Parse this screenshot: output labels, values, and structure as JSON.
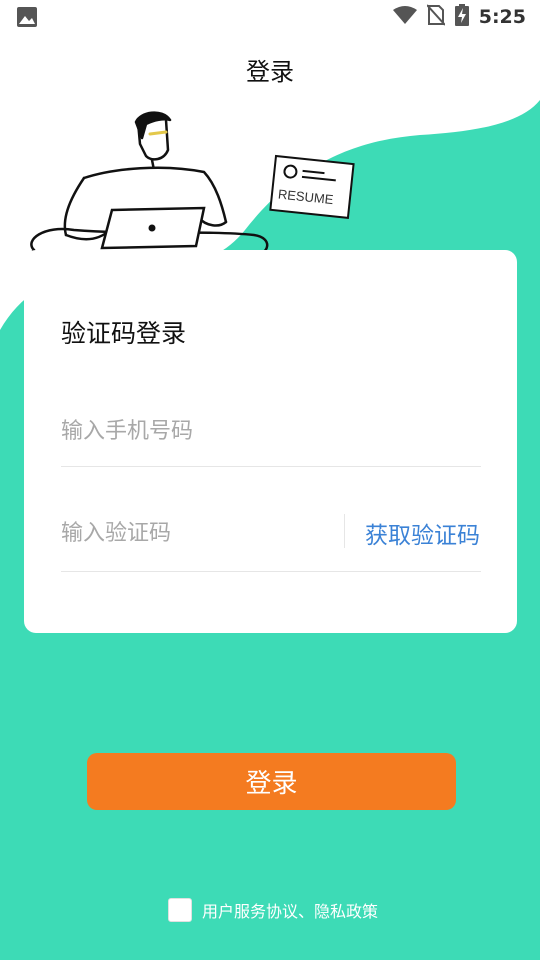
{
  "status_bar": {
    "time": "5:25"
  },
  "header": {
    "title": "登录"
  },
  "illustration": {
    "paper_text": "RESUME"
  },
  "card": {
    "title": "验证码登录",
    "phone_placeholder": "输入手机号码",
    "code_placeholder": "输入验证码",
    "get_code_label": "获取验证码"
  },
  "login_button": {
    "label": "登录"
  },
  "agreement": {
    "label": "用户服务协议、隐私政策",
    "checked": false
  },
  "colors": {
    "background": "#3ddbb6",
    "accent": "#f47b20",
    "link": "#3b82d6"
  }
}
